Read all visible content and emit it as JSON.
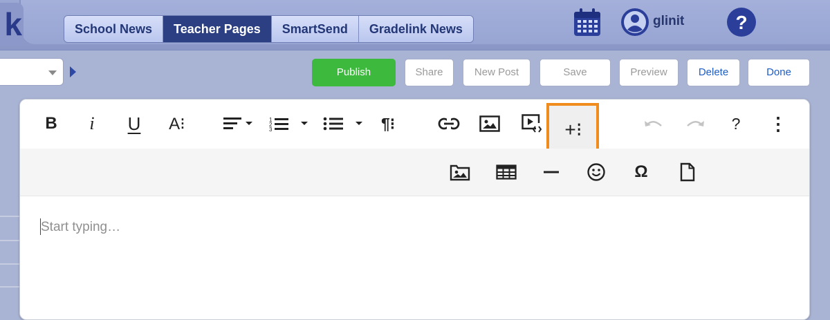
{
  "header": {
    "logo_text": "k",
    "tabs": [
      {
        "label": "School News"
      },
      {
        "label": "Teacher Pages"
      },
      {
        "label": "SmartSend"
      },
      {
        "label": "Gradelink News"
      }
    ],
    "active_tab": "Teacher Pages",
    "user_name": "glinit",
    "icons": [
      "calendar-icon",
      "user-avatar-icon",
      "help-icon"
    ]
  },
  "actions": {
    "publish": "Publish",
    "share": "Share",
    "new_post": "New Post",
    "save": "Save",
    "preview": "Preview",
    "delete": "Delete",
    "done": "Done"
  },
  "editor": {
    "toolbar_row1": [
      {
        "name": "bold",
        "glyph": "B"
      },
      {
        "name": "italic",
        "glyph": "i"
      },
      {
        "name": "underline",
        "glyph": "U"
      },
      {
        "name": "font-size",
        "glyph": "A⁝"
      },
      {
        "name": "align"
      },
      {
        "name": "ordered-list"
      },
      {
        "name": "unordered-list"
      },
      {
        "name": "paragraph-format",
        "glyph": "¶⁝"
      },
      {
        "name": "insert-link"
      },
      {
        "name": "insert-image"
      },
      {
        "name": "insert-video"
      },
      {
        "name": "more-insert",
        "glyph": "+⁝"
      },
      {
        "name": "undo"
      },
      {
        "name": "redo"
      },
      {
        "name": "help",
        "glyph": "?"
      },
      {
        "name": "more-options",
        "glyph": "⋮"
      }
    ],
    "toolbar_row2": [
      {
        "name": "image-manager"
      },
      {
        "name": "insert-table"
      },
      {
        "name": "horizontal-line"
      },
      {
        "name": "emoticons"
      },
      {
        "name": "special-characters",
        "glyph": "Ω"
      },
      {
        "name": "insert-file"
      }
    ],
    "placeholder": "Start typing…"
  },
  "colors": {
    "accent": "#2b3f82",
    "publish": "#3dba3d",
    "highlight": "#f08c1e",
    "link_blue": "#1d5cc7"
  }
}
